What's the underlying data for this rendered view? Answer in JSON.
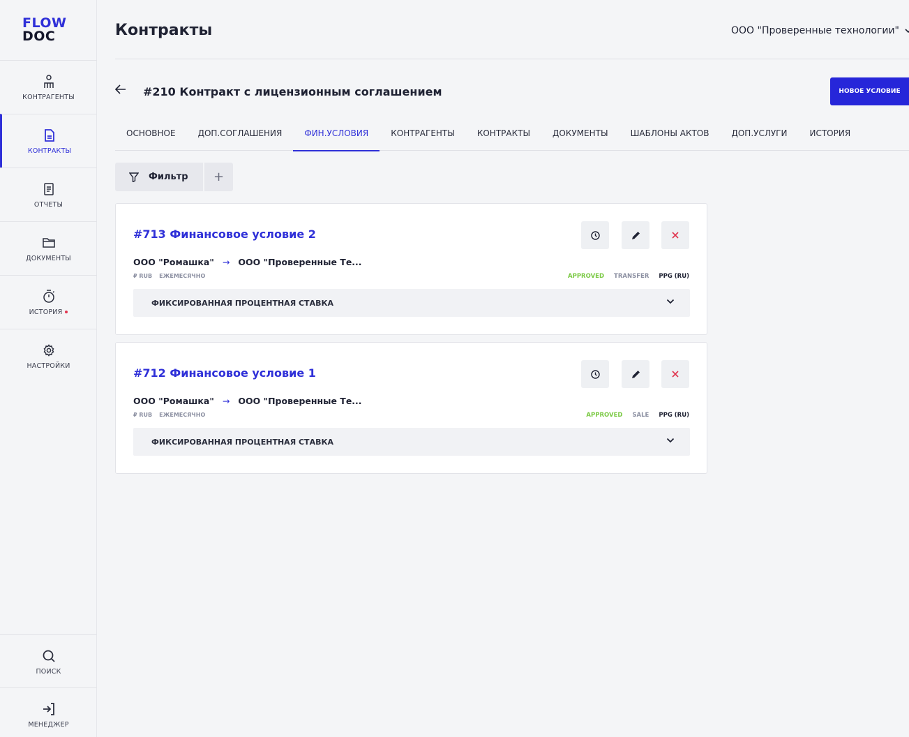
{
  "logo": {
    "line1": "FLOW",
    "line2": "DOC"
  },
  "sidebar": {
    "items": [
      {
        "label": "КОНТРАГЕНТЫ"
      },
      {
        "label": "КОНТРАКТЫ"
      },
      {
        "label": "ОТЧЕТЫ"
      },
      {
        "label": "ДОКУМЕНТЫ"
      },
      {
        "label": "ИСТОРИЯ"
      },
      {
        "label": "НАСТРОЙКИ"
      }
    ],
    "bottom": [
      {
        "label": "ПОИСК"
      },
      {
        "label": "МЕНЕДЖЕР"
      }
    ]
  },
  "header": {
    "title": "Контракты",
    "org": "ООО \"Проверенные технологии\""
  },
  "contract": {
    "title": "#210 Контракт с лицензионным соглашением",
    "new_button": "НОВОЕ УСЛОВИЕ"
  },
  "tabs": [
    {
      "label": "ОСНОВНОЕ"
    },
    {
      "label": "ДОП.СОГЛАШЕНИЯ"
    },
    {
      "label": "ФИН.УСЛОВИЯ"
    },
    {
      "label": "КОНТРАГЕНТЫ"
    },
    {
      "label": "КОНТРАКТЫ"
    },
    {
      "label": "ДОКУМЕНТЫ"
    },
    {
      "label": "ШАБЛОНЫ АКТОВ"
    },
    {
      "label": "ДОП.УСЛУГИ"
    },
    {
      "label": "ИСТОРИЯ"
    }
  ],
  "filter": {
    "label": "Фильтр",
    "add": "+"
  },
  "conditions": [
    {
      "title": "#713 Финансовое условие 2",
      "from": "ООО \"Ромашка\"",
      "to": "ООО \"Проверенные Те...",
      "currency": "₽ RUB",
      "period": "ЕЖЕМЕСЯЧНО",
      "status": "APPROVED",
      "type": "TRANSFER",
      "ppg": "PPG (RU)",
      "rate": "ФИКСИРОВАННАЯ ПРОЦЕНТНАЯ СТАВКА"
    },
    {
      "title": "#712 Финансовое условие 1",
      "from": "ООО \"Ромашка\"",
      "to": "ООО \"Проверенные Те...",
      "currency": "₽ RUB",
      "period": "ЕЖЕМЕСЯЧНО",
      "status": "APPROVED",
      "type": "SALE",
      "ppg": "PPG (RU)",
      "rate": "ФИКСИРОВАННАЯ ПРОЦЕНТНАЯ СТАВКА"
    }
  ],
  "arrow_glyph": "→"
}
